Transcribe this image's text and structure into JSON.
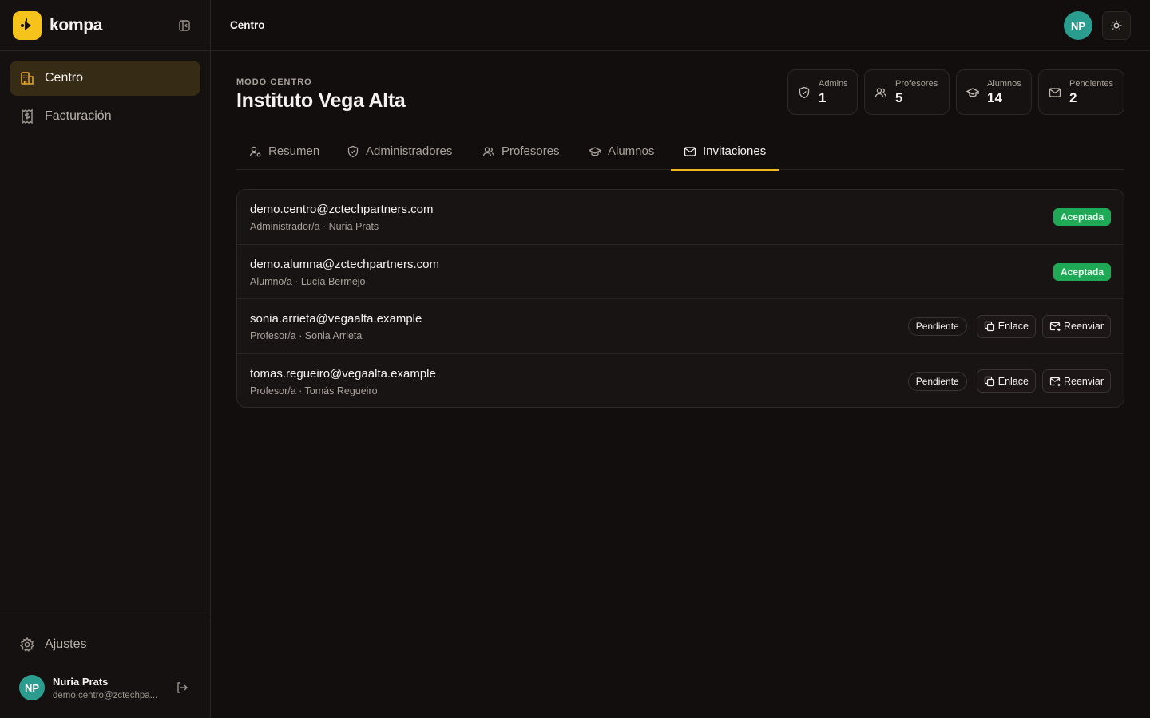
{
  "app": {
    "name": "kompa",
    "brand_color": "#f6c21c",
    "accent_color": "#f0b81c"
  },
  "sidebar": {
    "items": [
      {
        "label": "Centro",
        "icon": "building-icon",
        "active": true
      },
      {
        "label": "Facturación",
        "icon": "receipt-icon",
        "active": false
      }
    ],
    "settings_label": "Ajustes",
    "user": {
      "initials": "NP",
      "name": "Nuria Prats",
      "email": "demo.centro@zctechpa..."
    }
  },
  "topbar": {
    "title": "Centro",
    "avatar_initials": "NP"
  },
  "page": {
    "eyebrow": "MODO CENTRO",
    "title": "Instituto Vega Alta"
  },
  "stats": [
    {
      "label": "Admins",
      "value": "1",
      "icon": "shield-icon"
    },
    {
      "label": "Profesores",
      "value": "5",
      "icon": "users-icon"
    },
    {
      "label": "Alumnos",
      "value": "14",
      "icon": "graduation-cap-icon"
    },
    {
      "label": "Pendientes",
      "value": "2",
      "icon": "mail-icon"
    }
  ],
  "tabs": [
    {
      "label": "Resumen",
      "icon": "user-cog-icon",
      "active": false
    },
    {
      "label": "Administradores",
      "icon": "shield-icon",
      "active": false
    },
    {
      "label": "Profesores",
      "icon": "users-icon",
      "active": false
    },
    {
      "label": "Alumnos",
      "icon": "graduation-cap-icon",
      "active": false
    },
    {
      "label": "Invitaciones",
      "icon": "mail-icon",
      "active": true
    }
  ],
  "invitations": [
    {
      "email": "demo.centro@zctechpartners.com",
      "meta": "Administrador/a · Nuria Prats",
      "status": "Aceptada"
    },
    {
      "email": "demo.alumna@zctechpartners.com",
      "meta": "Alumno/a · Lucía Bermejo",
      "status": "Aceptada"
    },
    {
      "email": "sonia.arrieta@vegaalta.example",
      "meta": "Profesor/a · Sonia Arrieta",
      "status": "Pendiente",
      "link_label": "Enlace",
      "resend_label": "Reenviar"
    },
    {
      "email": "tomas.regueiro@vegaalta.example",
      "meta": "Profesor/a · Tomás Regueiro",
      "status": "Pendiente",
      "link_label": "Enlace",
      "resend_label": "Reenviar"
    }
  ]
}
